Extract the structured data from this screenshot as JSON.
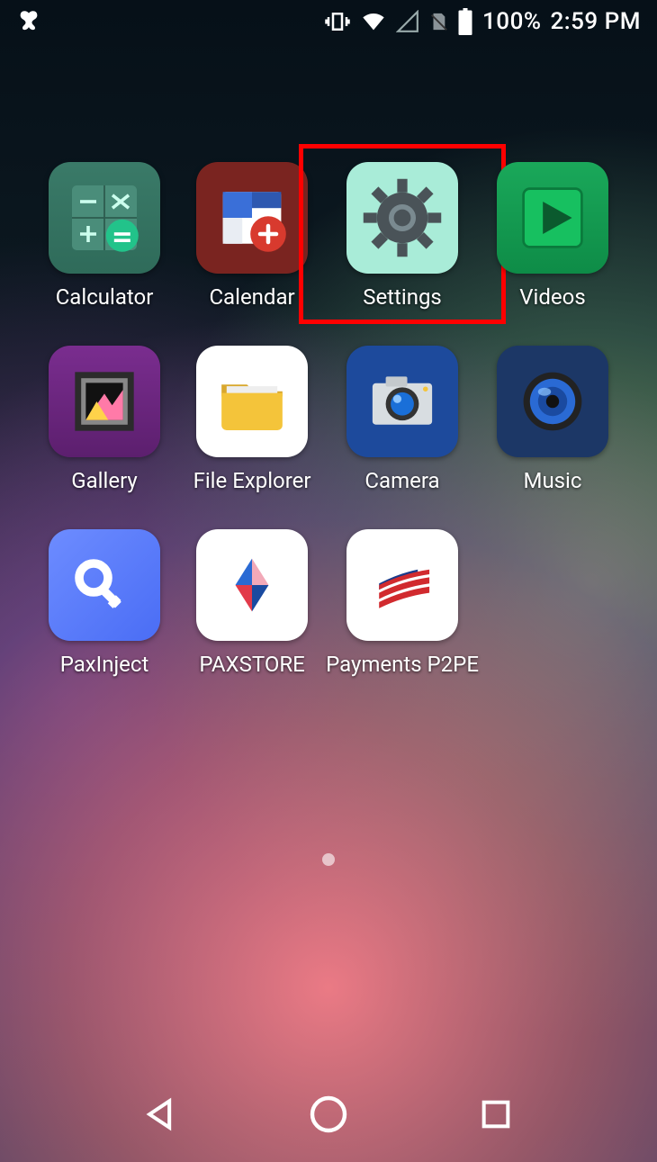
{
  "status": {
    "battery_pct": "100%",
    "clock": "2:59 PM"
  },
  "apps": [
    {
      "id": "calculator",
      "label": "Calculator"
    },
    {
      "id": "calendar",
      "label": "Calendar"
    },
    {
      "id": "settings",
      "label": "Settings",
      "highlighted": true
    },
    {
      "id": "videos",
      "label": "Videos"
    },
    {
      "id": "gallery",
      "label": "Gallery"
    },
    {
      "id": "file-explorer",
      "label": "File Explorer"
    },
    {
      "id": "camera",
      "label": "Camera"
    },
    {
      "id": "music",
      "label": "Music"
    },
    {
      "id": "paxinject",
      "label": "PaxInject"
    },
    {
      "id": "paxstore",
      "label": "PAXSTORE"
    },
    {
      "id": "payments",
      "label": "Payments P2PE"
    }
  ]
}
